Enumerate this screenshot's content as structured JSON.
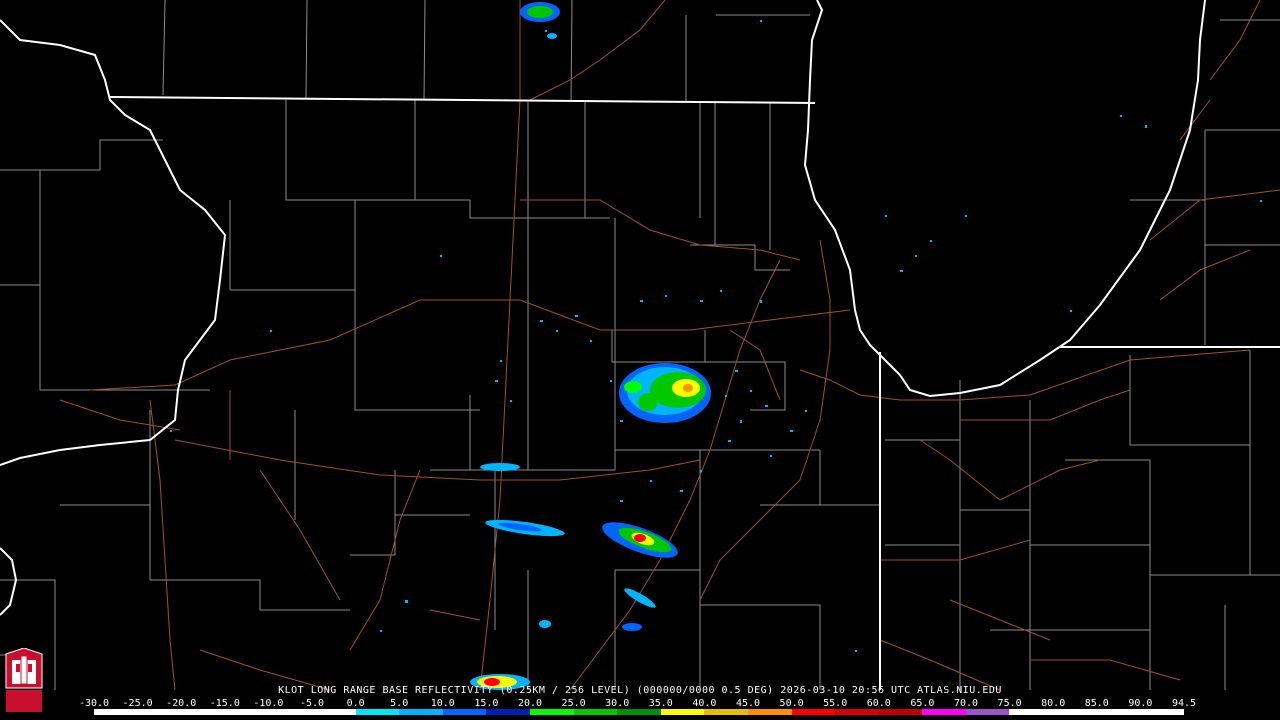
{
  "title": "KLOT LONG RANGE BASE REFLECTIVITY (0.25KM / 256 LEVEL) (000000/0000 0.5 DEG) 2026-03-10 20:56 UTC  ATLAS.NIU.EDU",
  "colorbar": {
    "labels": [
      "-30.0",
      "-25.0",
      "-20.0",
      "-15.0",
      "-10.0",
      "-5.0",
      "0.0",
      "5.0",
      "10.0",
      "15.0",
      "20.0",
      "25.0",
      "30.0",
      "35.0",
      "40.0",
      "45.0",
      "50.0",
      "55.0",
      "60.0",
      "65.0",
      "70.0",
      "75.0",
      "80.0",
      "85.0",
      "90.0",
      "94.5"
    ],
    "colors": [
      "#ffffff",
      "#ffffff",
      "#ffffff",
      "#ffffff",
      "#ffffff",
      "#ffffff",
      "#00e5ff",
      "#00b4ff",
      "#0064ff",
      "#001eb4",
      "#00ff00",
      "#00c800",
      "#009000",
      "#ffff00",
      "#e6c000",
      "#ff9000",
      "#ff0000",
      "#d60000",
      "#c00000",
      "#ff00ff",
      "#9955c9",
      "#ffffff",
      "#ffffff",
      "#ffffff",
      "#ffffff"
    ]
  },
  "logo": {
    "text": "NIU",
    "color": "#c8102e"
  },
  "colors": {
    "county": "#8c8c8c",
    "state": "#ffffff",
    "road": "#a0522d"
  }
}
